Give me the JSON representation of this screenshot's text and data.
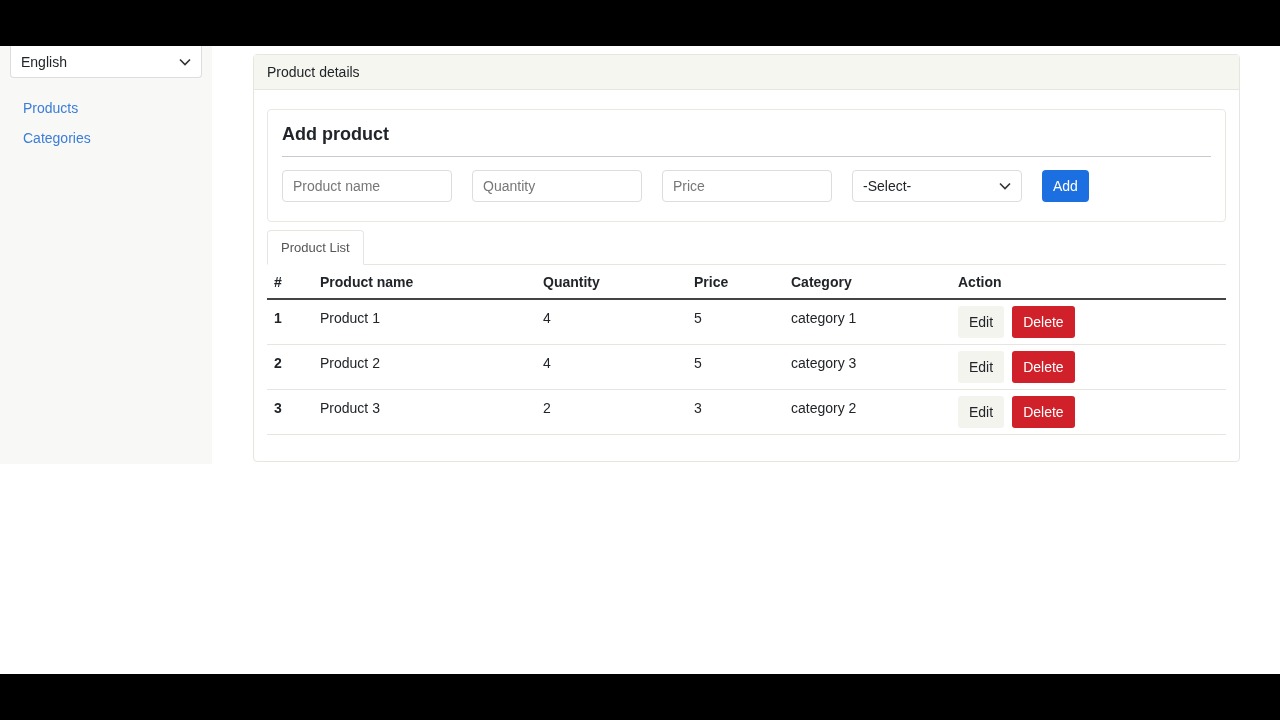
{
  "sidebar": {
    "language": "English",
    "links": [
      {
        "label": "Products"
      },
      {
        "label": "Categories"
      }
    ]
  },
  "panel": {
    "title": "Product details",
    "form": {
      "title": "Add product",
      "fields": [
        {
          "kind": "input",
          "placeholder": "Product name"
        },
        {
          "kind": "input",
          "placeholder": "Quantity"
        },
        {
          "kind": "input",
          "placeholder": "Price"
        },
        {
          "kind": "select",
          "value": "-Select-"
        }
      ],
      "button": "Add"
    },
    "tabs": [
      {
        "label": "Product List",
        "selected": true
      }
    ],
    "table": {
      "columns": [
        "#",
        "Product name",
        "Quantity",
        "Price",
        "Category",
        "Action"
      ],
      "rows": [
        {
          "cells": [
            "1",
            "Product 1",
            "4",
            "5",
            "category 1"
          ],
          "actions": [
            {
              "label": "Edit",
              "kind": "secondary"
            },
            {
              "label": "Delete",
              "kind": "danger"
            }
          ]
        },
        {
          "cells": [
            "2",
            "Product 2",
            "4",
            "5",
            "category 3"
          ],
          "actions": [
            {
              "label": "Edit",
              "kind": "secondary"
            },
            {
              "label": "Delete",
              "kind": "danger"
            }
          ]
        },
        {
          "cells": [
            "3",
            "Product 3",
            "2",
            "3",
            "category 2"
          ],
          "actions": [
            {
              "label": "Edit",
              "kind": "secondary"
            },
            {
              "label": "Delete",
              "kind": "danger"
            }
          ]
        }
      ]
    }
  }
}
